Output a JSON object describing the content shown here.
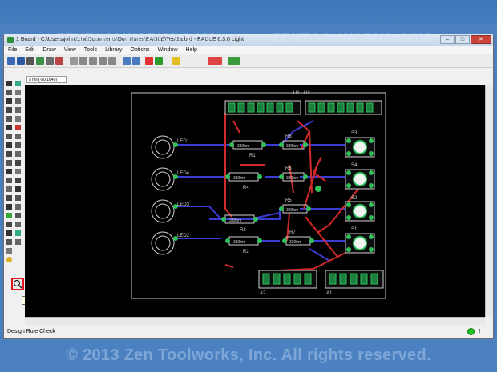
{
  "window": {
    "title": "1 Board - C:\\Users\\john2ztw\\Documents\\Don Notes\\EAGLE\\Test1a.brd - EAGLE 6.3.0 Light"
  },
  "menu": [
    "File",
    "Edit",
    "Draw",
    "View",
    "Tools",
    "Library",
    "Options",
    "Window",
    "Help"
  ],
  "watermark": [
    "ZENTOOLWORKS.COM",
    "ZENTOOLWORKS.COM"
  ],
  "param": {
    "coord": "5 mil (-50 1840)"
  },
  "board": {
    "leds": [
      "LED1",
      "LED4",
      "LED3",
      "LED2"
    ],
    "resistors": [
      "R1",
      "R4",
      "R3",
      "R2",
      "R5",
      "R6",
      "R7",
      "R8"
    ],
    "resistor_value": "330hm",
    "switches": [
      "S4",
      "S3",
      "S2",
      "S1"
    ],
    "headers": [
      "U1",
      "U2",
      "A2",
      "A1"
    ]
  },
  "tooltip": "DRC",
  "status": {
    "text": "Design Rule Check",
    "stop": "!"
  },
  "footer": "© 2013 Zen Toolworks, Inc. All rights reserved.",
  "colors": {
    "trace_blue": "#3b3bd6",
    "trace_red": "#d22a2a",
    "pad_green": "#2ec15a",
    "outline": "#c8c8c8"
  }
}
